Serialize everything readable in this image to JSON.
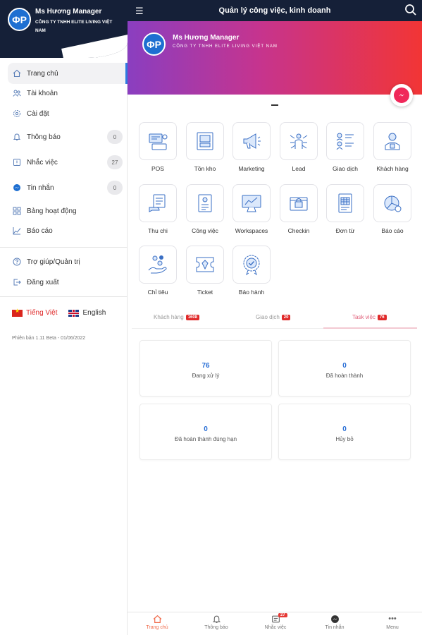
{
  "sidebar": {
    "profile_name": "Ms Hương Manager",
    "company": "CÔNG TY TNHH ELITE LIVING VIỆT NAM",
    "logo": "ΦΡ",
    "menu": [
      {
        "label": "Trang chủ",
        "icon": "home-icon"
      },
      {
        "label": "Tài khoản",
        "icon": "users-icon"
      },
      {
        "label": "Cài đặt",
        "icon": "gear-icon"
      },
      {
        "label": "Thông báo",
        "icon": "bell-icon",
        "badge": "0"
      },
      {
        "label": "Nhắc việc",
        "icon": "alert-icon",
        "badge": "27"
      },
      {
        "label": "Tin nhắn",
        "icon": "messenger-icon",
        "badge": "0"
      },
      {
        "label": "Bảng hoạt động",
        "icon": "grid-icon"
      },
      {
        "label": "Báo cáo",
        "icon": "chart-icon"
      },
      {
        "label": "Trợ giúp/Quản trị",
        "icon": "help-icon"
      },
      {
        "label": "Đăng xuất",
        "icon": "logout-icon"
      }
    ],
    "lang_vi": "Tiếng Việt",
    "lang_en": "English",
    "version": "Phiên bản 1.11 Beta - 01/06/2022"
  },
  "topbar": {
    "title": "Quản lý công việc, kinh doanh"
  },
  "banner": {
    "name": "Ms Hương Manager",
    "company": "CÔNG TY TNHH ELITE LIVING VIỆT NAM",
    "logo": "ΦΡ"
  },
  "modules": [
    {
      "label": "POS",
      "icon": "pos-icon"
    },
    {
      "label": "Tồn kho",
      "icon": "inventory-icon"
    },
    {
      "label": "Marketing",
      "icon": "megaphone-icon"
    },
    {
      "label": "Lead",
      "icon": "lead-icon"
    },
    {
      "label": "Giao dịch",
      "icon": "transaction-icon"
    },
    {
      "label": "Khách hàng",
      "icon": "customer-icon"
    },
    {
      "label": "Thu chi",
      "icon": "cashflow-icon"
    },
    {
      "label": "Công việc",
      "icon": "task-icon"
    },
    {
      "label": "Workspaces",
      "icon": "workspace-icon"
    },
    {
      "label": "Checkin",
      "icon": "checkin-icon"
    },
    {
      "label": "Đơn từ",
      "icon": "form-icon"
    },
    {
      "label": "Báo cáo",
      "icon": "report-icon"
    },
    {
      "label": "Chỉ tiêu",
      "icon": "target-icon"
    },
    {
      "label": "Ticket",
      "icon": "ticket-icon"
    },
    {
      "label": "Bảo hành",
      "icon": "warranty-icon"
    }
  ],
  "tabs": [
    {
      "label": "Khách hàng",
      "count": "1608"
    },
    {
      "label": "Giao dịch",
      "count": "20"
    },
    {
      "label": "Task việc",
      "count": "76"
    }
  ],
  "stats": [
    {
      "value": "76",
      "label": "Đang xử lý"
    },
    {
      "value": "0",
      "label": "Đã hoàn thành"
    },
    {
      "value": "0",
      "label": "Đã hoàn thành đúng hạn"
    },
    {
      "value": "0",
      "label": "Hủy bỏ"
    }
  ],
  "bottom_nav": [
    {
      "label": "Trang chủ",
      "icon": "home-icon"
    },
    {
      "label": "Thông báo",
      "icon": "bell-icon"
    },
    {
      "label": "Nhắc việc",
      "icon": "reminder-icon",
      "badge": "27"
    },
    {
      "label": "Tin nhắn",
      "icon": "messenger-icon"
    },
    {
      "label": "Menu",
      "icon": "more-icon"
    }
  ],
  "colors": {
    "accent": "#2e7be0",
    "dark": "#152038",
    "danger": "#e02a2a"
  }
}
